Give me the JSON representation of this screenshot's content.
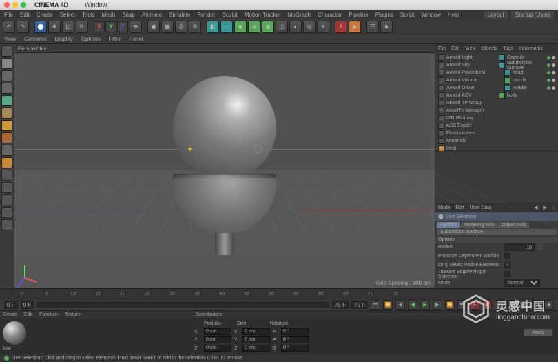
{
  "titlebar": {
    "app": "CINEMA 4D",
    "menu": "Window"
  },
  "menubar": {
    "items": [
      "File",
      "Edit",
      "Create",
      "Select",
      "Tools",
      "Mesh",
      "Snap",
      "Animate",
      "Simulate",
      "Render",
      "Sculpt",
      "Motion Tracker",
      "MoGraph",
      "Character",
      "Pipeline",
      "Plugins",
      "Script",
      "Window",
      "Help"
    ],
    "layout_label": "Layout",
    "layout_value": "Startup (User)"
  },
  "subbar": {
    "items": [
      "View",
      "Cameras",
      "Display",
      "Options",
      "Filter",
      "Panel"
    ]
  },
  "viewport": {
    "tab": "Perspective",
    "footer_label": "Grid Spacing",
    "footer_value": "100 cm"
  },
  "arnold_menu": {
    "tabs": [
      "File",
      "Edit",
      "View",
      "Objects",
      "Tags",
      "Bookmarks"
    ],
    "items": [
      "Arnold Light",
      "Arnold Sky",
      "Arnold Procedural",
      "Arnold Volume",
      "Arnold Driver",
      "Arnold AOV",
      "Arnold TP Group",
      "AssetTx Manager",
      "IPR Window",
      "ASS Export",
      "Flush caches",
      "Materials",
      "Help"
    ]
  },
  "hierarchy": {
    "tabs": [
      "File",
      "Edit",
      "View",
      "Objects",
      "Tags",
      "Bookmarks"
    ],
    "items": [
      {
        "name": "Capsule",
        "icon": "teal"
      },
      {
        "name": "Subdivision Surface",
        "icon": "teal"
      },
      {
        "name": "head",
        "icon": "teal"
      },
      {
        "name": "nozzle",
        "icon": "green"
      },
      {
        "name": "middle",
        "icon": "teal"
      },
      {
        "name": "body",
        "icon": "green"
      }
    ]
  },
  "attributes": {
    "tabs": [
      "Mode",
      "Edit",
      "User Data"
    ],
    "tool_name": "Live Selection",
    "tab_options": "Options",
    "tab_modeling": "Modeling Axis",
    "tab_object": "Object Axis",
    "tab_subdiv": "Subdivision Surface",
    "section": "Options",
    "radius_label": "Radius",
    "radius_value": "10",
    "pressure_label": "Pressure Dependent Radius",
    "visible_label": "Only Select Visible Elements",
    "tolerant_label": "Tolerant Edge/Polygon Selection",
    "mode_label": "Mode",
    "mode_value": "Normal"
  },
  "timeline": {
    "start_frame": "0 F",
    "end_frame": "75 F",
    "current_frame": "0 F",
    "range_end": "75 F"
  },
  "materials": {
    "tabs": [
      "Create",
      "Edit",
      "Function",
      "Texture"
    ],
    "mat_name": "Mat"
  },
  "coordinates": {
    "position_label": "Position",
    "size_label": "Size",
    "rotation_label": "Rotation",
    "x": "X",
    "y": "Y",
    "z": "Z",
    "px": "0 cm",
    "py": "0 cm",
    "pz": "0 cm",
    "sx": "0 cm",
    "sy": "0 cm",
    "sz": "0 cm",
    "h": "H",
    "p": "P",
    "b": "B",
    "rh": "0 °",
    "rp": "0 °",
    "rb": "0 °",
    "apply": "Apply"
  },
  "watermark": {
    "cn": "灵感中国",
    "en": "lingganchina.com"
  },
  "statusbar": {
    "text": "Live Selection: Click and drag to select elements. Hold down SHIFT to add to the selection; CTRL to remove."
  }
}
